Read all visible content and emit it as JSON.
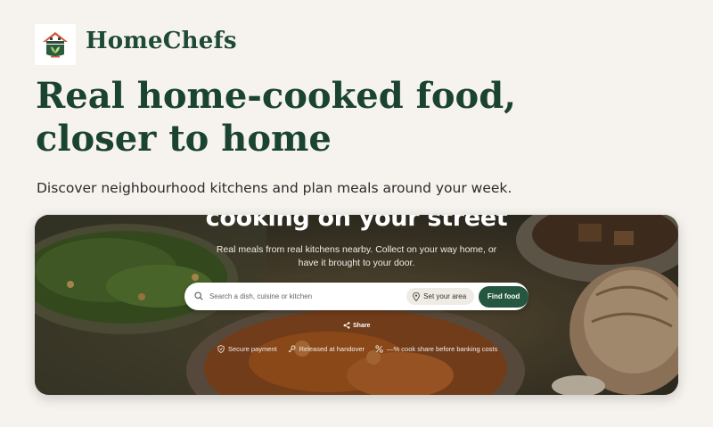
{
  "brand": {
    "name": "HomeChefs",
    "logo_icon": "house-with-leaves-icon"
  },
  "hero_heading": {
    "line1": "Real home-cooked food,",
    "line2": "closer to home"
  },
  "subtitle": "Discover neighbourhood kitchens and plan meals around your week.",
  "hero": {
    "title": "cooking on your street",
    "description": "Real meals from real kitchens nearby. Collect on your way home, or have it brought to your door.",
    "background": "food-photo-bowls",
    "search": {
      "placeholder": "Search a dish, cuisine or kitchen",
      "value": "",
      "icon": "search-icon"
    },
    "area_button": {
      "label": "Set your area",
      "icon": "location-pin-icon"
    },
    "find_button": {
      "label": "Find food"
    },
    "share": {
      "label": "Share",
      "icon": "share-icon"
    },
    "trust": [
      {
        "label": "Secure payment",
        "icon": "shield-icon"
      },
      {
        "label": "Released at handover",
        "icon": "key-icon"
      },
      {
        "label": "—% cook share before banking costs",
        "icon": "percent-icon"
      }
    ]
  },
  "colors": {
    "page_bg": "#f6f3ee",
    "brand_green": "#1f4a36",
    "button_green": "#25563f",
    "logo_roof": "#d9553a"
  }
}
